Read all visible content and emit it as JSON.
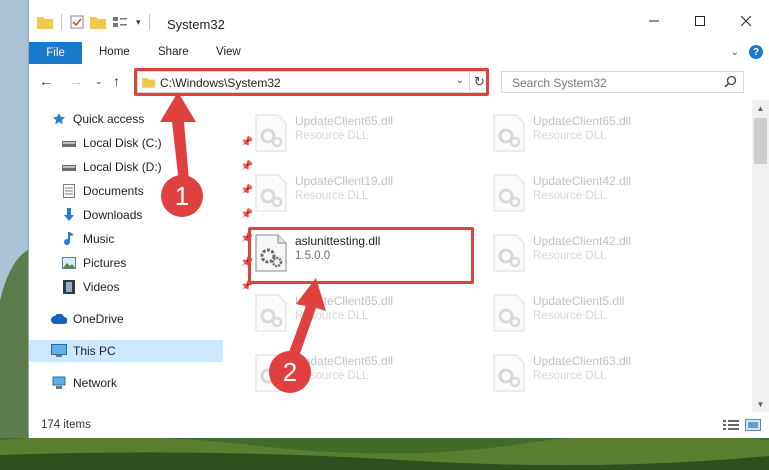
{
  "window": {
    "title": "System32"
  },
  "ribbon": {
    "tabs": [
      "File",
      "Home",
      "Share",
      "View"
    ]
  },
  "nav": {
    "address": "C:\\Windows\\System32",
    "search_placeholder": "Search System32"
  },
  "sidebar": {
    "items": [
      {
        "label": "Quick access",
        "icon": "star-icon",
        "pinned": false
      },
      {
        "label": "Local Disk (C:)",
        "icon": "drive-icon",
        "pinned": true
      },
      {
        "label": "Local Disk (D:)",
        "icon": "drive-icon",
        "pinned": true
      },
      {
        "label": "Documents",
        "icon": "documents-icon",
        "pinned": true
      },
      {
        "label": "Downloads",
        "icon": "download-icon",
        "pinned": true
      },
      {
        "label": "Music",
        "icon": "music-icon",
        "pinned": true
      },
      {
        "label": "Pictures",
        "icon": "pictures-icon",
        "pinned": true
      },
      {
        "label": "Videos",
        "icon": "videos-icon",
        "pinned": true
      },
      {
        "label": "OneDrive",
        "icon": "cloud-icon",
        "pinned": false
      },
      {
        "label": "This PC",
        "icon": "computer-icon",
        "pinned": false,
        "selected": true
      },
      {
        "label": "Network",
        "icon": "network-icon",
        "pinned": false
      }
    ]
  },
  "files": [
    {
      "name": "UpdateClient65.dll",
      "desc": "Resource DLL"
    },
    {
      "name": "UpdateClient65.dll",
      "desc": "Resource DLL"
    },
    {
      "name": "UpdateClient19.dll",
      "desc": "Resource DLL"
    },
    {
      "name": "UpdateClient42.dll",
      "desc": "Resource DLL"
    },
    {
      "name": "aslunittesting.dll",
      "desc": "1.5.0.0",
      "highlighted": true
    },
    {
      "name": "UpdateClient42.dll",
      "desc": "Resource DLL"
    },
    {
      "name": "UpdateClient65.dll",
      "desc": "Resource DLL"
    },
    {
      "name": "UpdateClient5.dll",
      "desc": "Resource DLL"
    },
    {
      "name": "UpdateClient65.dll",
      "desc": "Resource DLL"
    },
    {
      "name": "UpdateClient63.dll",
      "desc": "Resource DLL"
    }
  ],
  "status": {
    "items_count": "174 items"
  },
  "annotations": {
    "step1": "1",
    "step2": "2",
    "color": "#e0403f"
  },
  "colors": {
    "accent": "#1979ca",
    "selected_bg": "#cce8ff"
  }
}
